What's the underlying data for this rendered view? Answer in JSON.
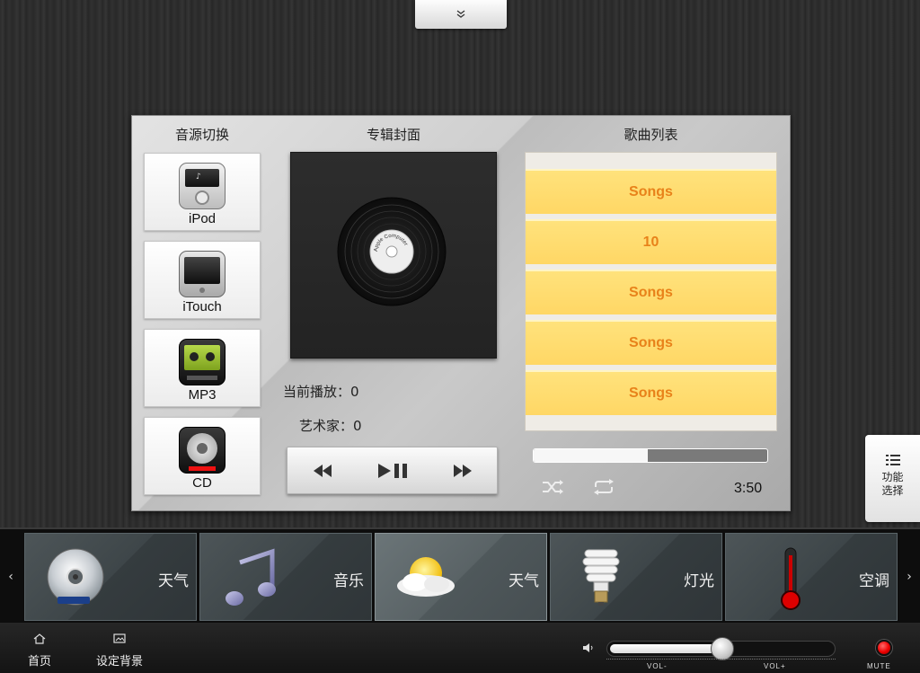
{
  "source_panel": {
    "title": "音源切换",
    "sources": [
      {
        "label": "iPod",
        "icon": "ipod-icon"
      },
      {
        "label": "iTouch",
        "icon": "itouch-icon"
      },
      {
        "label": "MP3",
        "icon": "mp3-player-icon"
      },
      {
        "label": "CD",
        "icon": "cd-remote-icon"
      }
    ]
  },
  "album_panel": {
    "title": "专辑封面",
    "record_label_text": "Apple Computer",
    "now_playing_label": "当前播放：",
    "now_playing_value": "0",
    "artist_label": "艺术家：",
    "artist_value": "0"
  },
  "playlist_panel": {
    "title": "歌曲列表",
    "songs": [
      "Songs",
      "10",
      "Songs",
      "Songs",
      "Songs"
    ],
    "progress": 0.49,
    "time": "3:50"
  },
  "function_button": {
    "line1": "功能",
    "line2": "选择"
  },
  "tiles": [
    {
      "label": "天气",
      "icon": "bluray-disc-icon"
    },
    {
      "label": "音乐",
      "icon": "music-note-icon"
    },
    {
      "label": "天气",
      "icon": "weather-sun-cloud-icon"
    },
    {
      "label": "灯光",
      "icon": "light-bulb-icon"
    },
    {
      "label": "空调",
      "icon": "thermometer-icon"
    }
  ],
  "bottom_nav": {
    "home": "首页",
    "background": "设定背景",
    "vol_minus": "VOL-",
    "vol_plus": "VOL+",
    "mute": "MUTE",
    "volume_level": 0.5
  },
  "colors": {
    "song_bg": "#ffd765",
    "song_text": "#e8821a",
    "mute": "#e00000"
  }
}
